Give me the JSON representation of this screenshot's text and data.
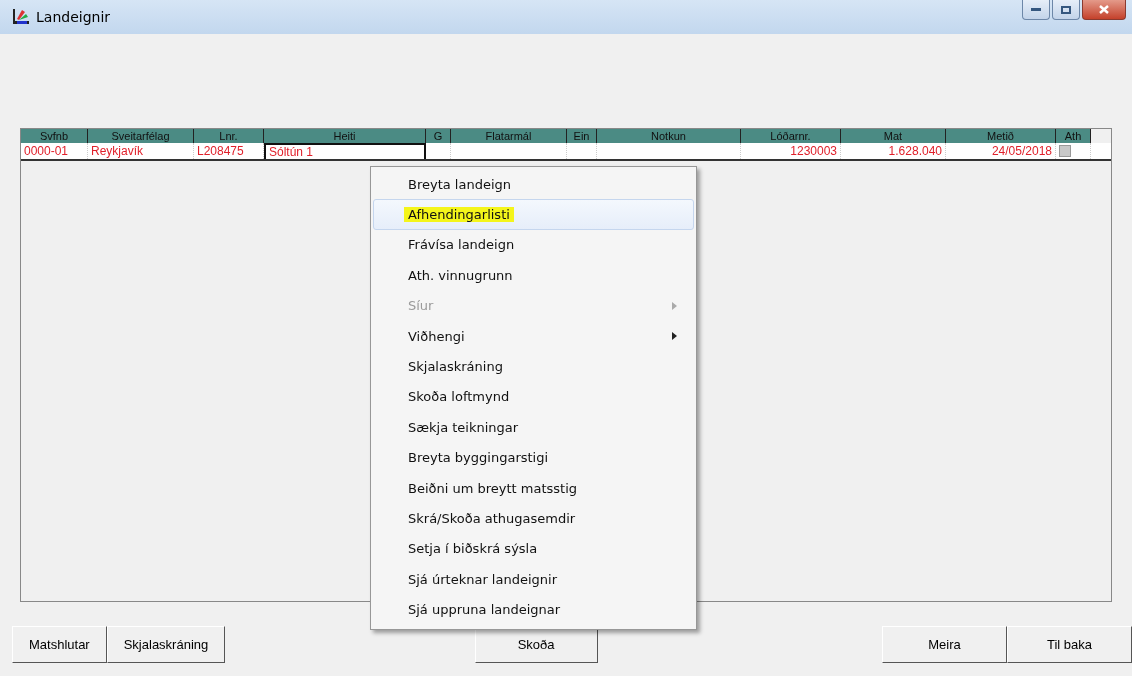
{
  "window": {
    "title": "Landeignir"
  },
  "table": {
    "columns": [
      {
        "label": "Svfnb"
      },
      {
        "label": "Sveitarfélag"
      },
      {
        "label": "Lnr."
      },
      {
        "label": "Heiti"
      },
      {
        "label": "G"
      },
      {
        "label": "Flatarmál"
      },
      {
        "label": "Ein"
      },
      {
        "label": "Notkun"
      },
      {
        "label": "Lóðarnr."
      },
      {
        "label": "Mat"
      },
      {
        "label": "Metið"
      },
      {
        "label": "Ath"
      }
    ],
    "rows": [
      {
        "cells": [
          "0000-01",
          "Reykjavík",
          "L208475",
          "Sóltún 1",
          "",
          "",
          "",
          "",
          "1230003",
          "1.628.040",
          "24/05/2018"
        ],
        "ath_checked": false
      }
    ]
  },
  "context_menu": {
    "items": [
      {
        "label": "Breyta landeign",
        "selected": false,
        "disabled": false,
        "submenu": false
      },
      {
        "label": "Afhendingarlisti",
        "selected": true,
        "disabled": false,
        "submenu": false
      },
      {
        "label": "Frávísa landeign",
        "selected": false,
        "disabled": false,
        "submenu": false
      },
      {
        "label": "Ath. vinnugrunn",
        "selected": false,
        "disabled": false,
        "submenu": false
      },
      {
        "label": "Síur",
        "selected": false,
        "disabled": true,
        "submenu": true
      },
      {
        "label": "Viðhengi",
        "selected": false,
        "disabled": false,
        "submenu": true
      },
      {
        "label": "Skjalaskráning",
        "selected": false,
        "disabled": false,
        "submenu": false
      },
      {
        "label": "Skoða loftmynd",
        "selected": false,
        "disabled": false,
        "submenu": false
      },
      {
        "label": "Sækja teikningar",
        "selected": false,
        "disabled": false,
        "submenu": false
      },
      {
        "label": "Breyta byggingarstigi",
        "selected": false,
        "disabled": false,
        "submenu": false
      },
      {
        "label": "Beiðni um breytt matsstig",
        "selected": false,
        "disabled": false,
        "submenu": false
      },
      {
        "label": "Skrá/Skoða athugasemdir",
        "selected": false,
        "disabled": false,
        "submenu": false
      },
      {
        "label": "Setja í biðskrá sýsla",
        "selected": false,
        "disabled": false,
        "submenu": false
      },
      {
        "label": "Sjá úrteknar landeignir",
        "selected": false,
        "disabled": false,
        "submenu": false
      },
      {
        "label": "Sjá uppruna landeignar",
        "selected": false,
        "disabled": false,
        "submenu": false
      }
    ]
  },
  "buttons": {
    "left": [
      "Matshlutar",
      "Skjalaskráning"
    ],
    "center": [
      "Skoða"
    ],
    "right": [
      "Meira",
      "Til baka"
    ]
  }
}
